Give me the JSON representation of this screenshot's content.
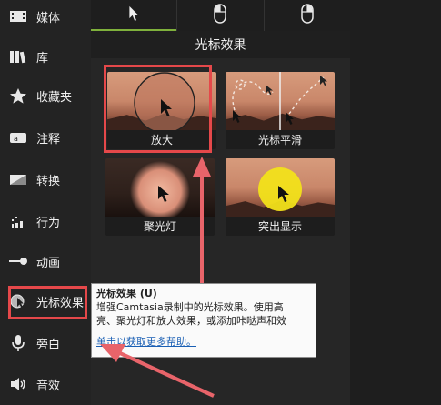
{
  "sidebar": {
    "items": [
      {
        "label": "媒体",
        "icon": "film-icon"
      },
      {
        "label": "库",
        "icon": "library-icon"
      },
      {
        "label": "收藏夹",
        "icon": "star-icon"
      },
      {
        "label": "注释",
        "icon": "annotation-icon"
      },
      {
        "label": "转换",
        "icon": "transition-icon"
      },
      {
        "label": "行为",
        "icon": "behavior-icon"
      },
      {
        "label": "动画",
        "icon": "animation-icon"
      },
      {
        "label": "光标效果",
        "icon": "cursor-effect-icon"
      },
      {
        "label": "旁白",
        "icon": "microphone-icon"
      },
      {
        "label": "音效",
        "icon": "speaker-icon"
      }
    ]
  },
  "tabs": [
    {
      "icon": "cursor-arrow-icon"
    },
    {
      "icon": "mouse-left-icon"
    },
    {
      "icon": "mouse-right-icon"
    }
  ],
  "panel": {
    "title": "光标效果",
    "tiles": [
      {
        "label": "放大"
      },
      {
        "label": "光标平滑"
      },
      {
        "label": "聚光灯"
      },
      {
        "label": "突出显示"
      }
    ]
  },
  "tooltip": {
    "title": "光标效果 (U)",
    "line1": "增强Camtasia录制中的光标效果。使用高",
    "line2": "亮、聚光灯和放大效果，或添加咔哒声和效",
    "link": "单击以获取更多帮助。"
  },
  "colors": {
    "accent": "#7fb13c",
    "highlight": "#e5484a",
    "sidebar": "#232323"
  }
}
